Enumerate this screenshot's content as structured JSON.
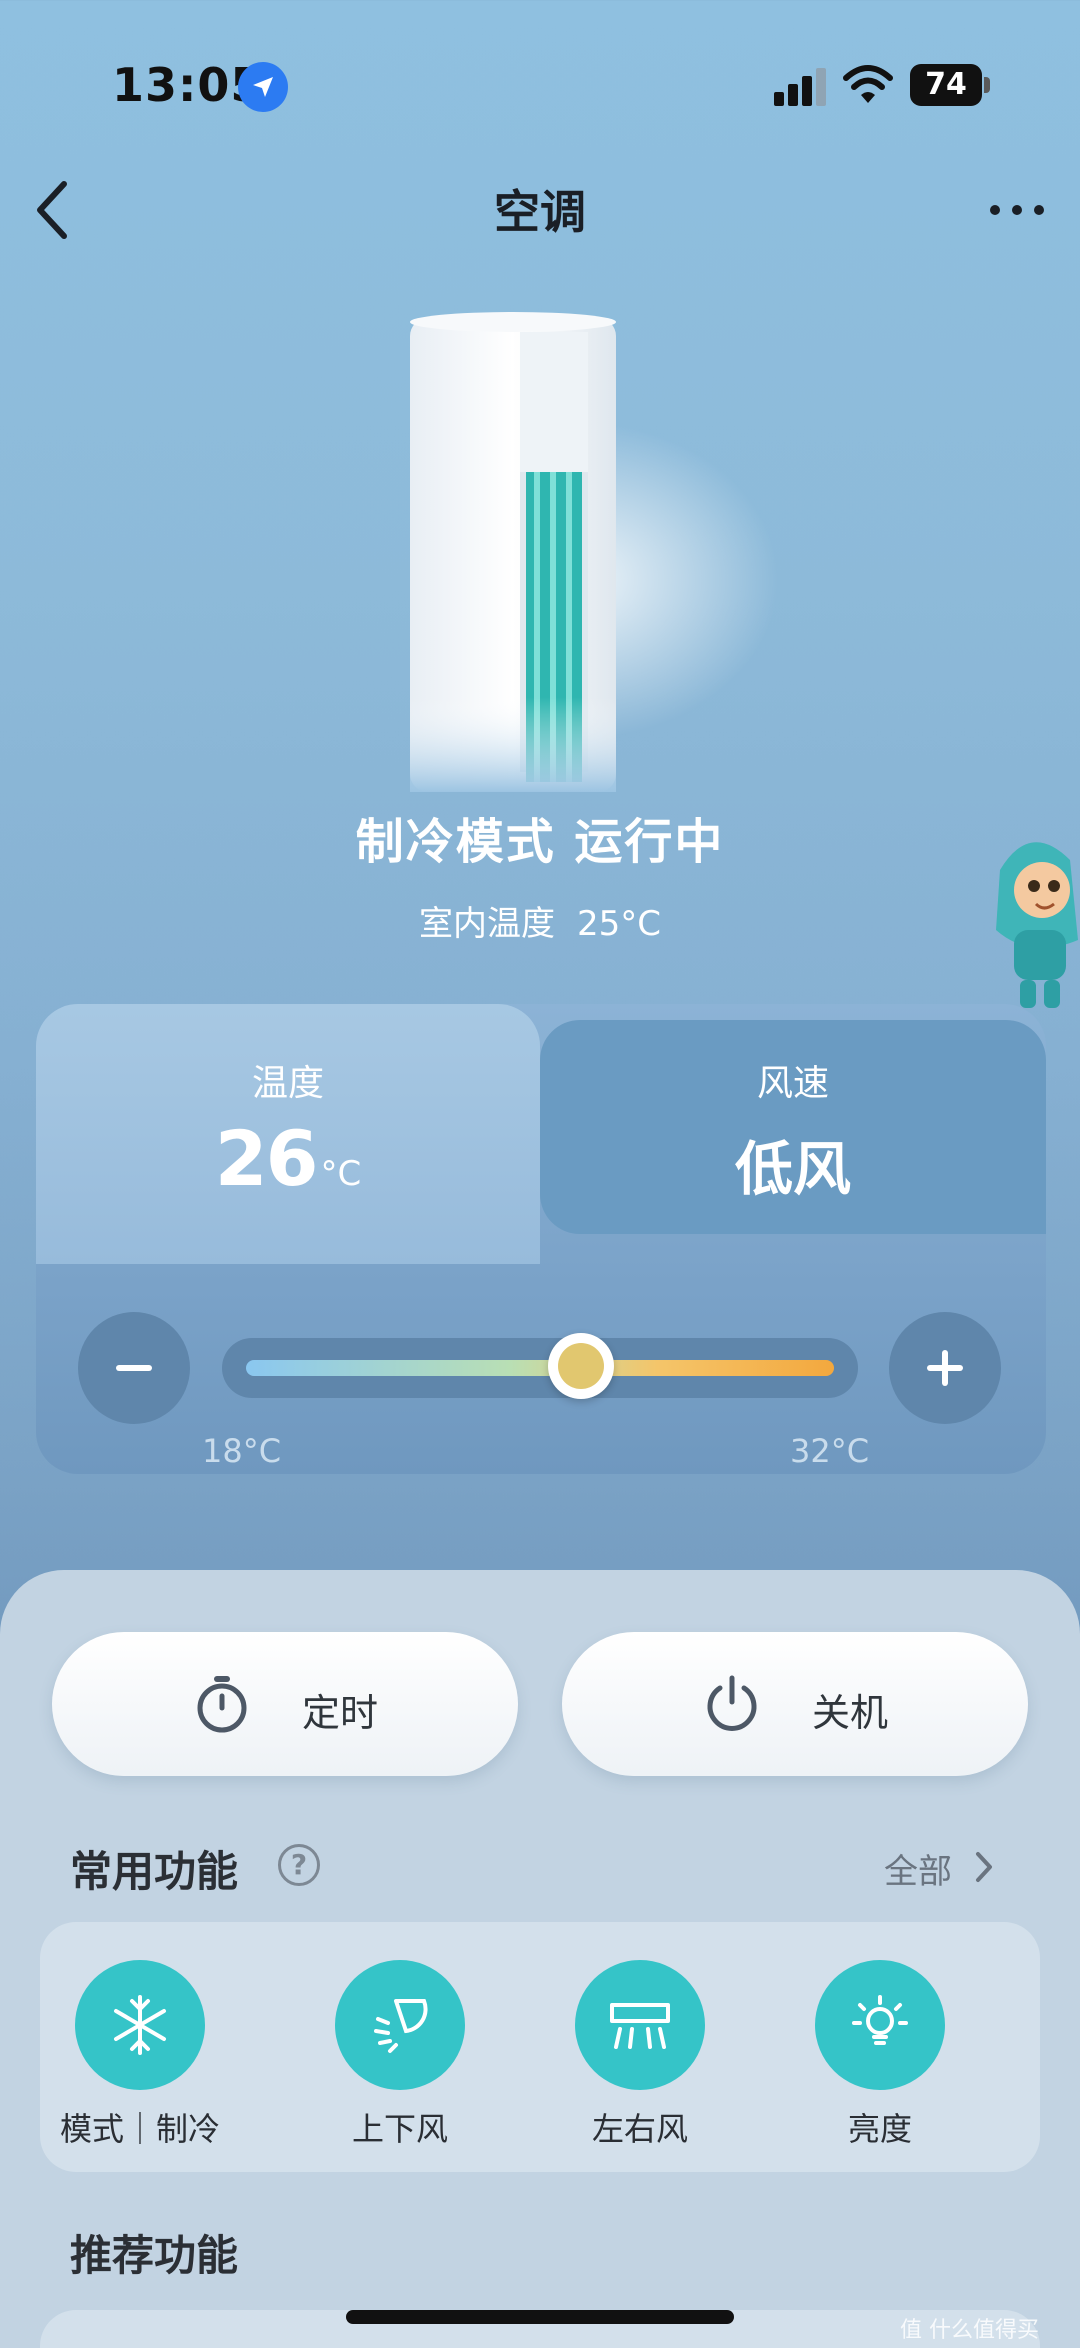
{
  "status_bar": {
    "time": "13:05",
    "battery": "74"
  },
  "nav": {
    "title": "空调"
  },
  "device": {
    "mode_status": "制冷模式 运行中",
    "indoor_label": "室内温度",
    "indoor_value": "25°C"
  },
  "control": {
    "temp_tab_label": "温度",
    "temp_value": "26",
    "temp_unit": "°C",
    "wind_tab_label": "风速",
    "wind_value": "低风",
    "range_min": "18°C",
    "range_max": "32°C",
    "slider_level": 0.57
  },
  "actions": {
    "timer_label": "定时",
    "power_label": "关机"
  },
  "common": {
    "title": "常用功能",
    "help_glyph": "?",
    "all_label": "全部",
    "items": [
      {
        "label": "模式｜制冷",
        "icon": "snowflake-icon"
      },
      {
        "label": "上下风",
        "icon": "vertical-swing-icon"
      },
      {
        "label": "左右风",
        "icon": "horizontal-swing-icon"
      },
      {
        "label": "亮度",
        "icon": "lightbulb-icon"
      }
    ]
  },
  "recommend": {
    "title": "推荐功能"
  },
  "watermark": "值 什么值得买",
  "colors": {
    "accent": "#35c4c8",
    "card": "#6a9bc2",
    "sheet": "#c2d3e2"
  }
}
